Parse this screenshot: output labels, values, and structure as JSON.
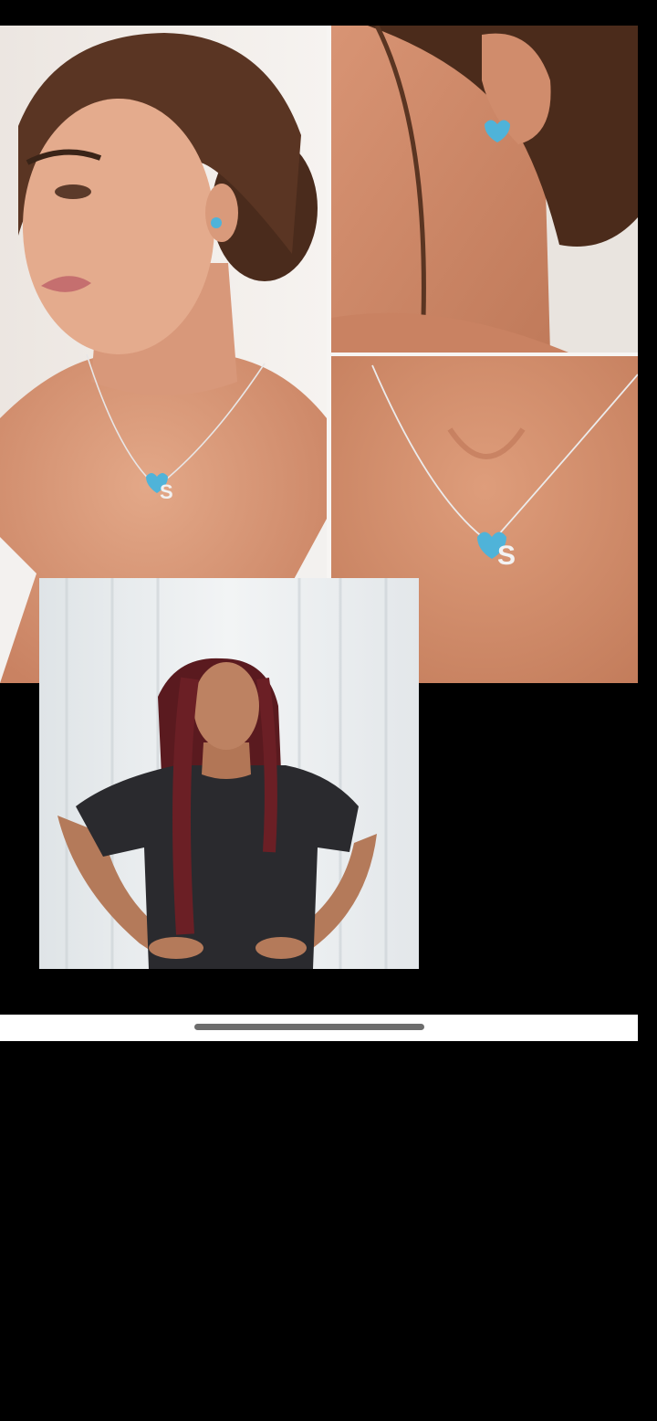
{
  "screen": {
    "background": "#000000"
  },
  "collage": {
    "main_photo": {
      "icon": "woman-necklace-photo"
    },
    "ear_photo": {
      "icon": "earring-closeup-photo"
    },
    "neck_photo": {
      "icon": "necklace-closeup-photo"
    },
    "pendant_letter": "S",
    "gem_color": "#4fb3d9",
    "divider_color": "#f7f5f3"
  },
  "pip": {
    "icon": "video-person-photo"
  },
  "bottom_bar": {
    "background": "#ffffff",
    "handle_color": "#6d6d6d"
  }
}
